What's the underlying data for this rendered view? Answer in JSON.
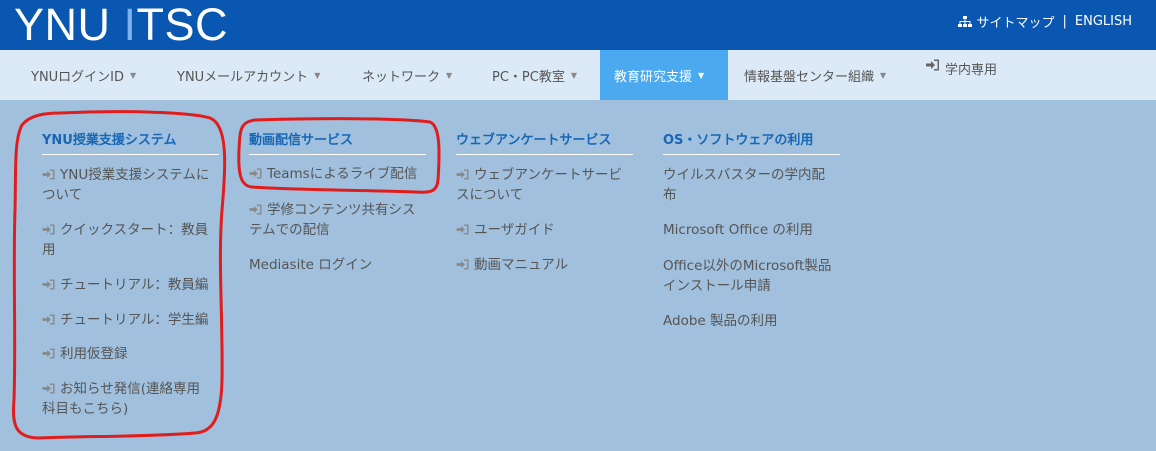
{
  "header": {
    "logo_main": "YNU ",
    "logo_i": "I",
    "logo_rest": "TSC",
    "sitemap_label": "サイトマップ",
    "separator": "|",
    "english_label": "ENGLISH",
    "sitemap_icon": "sitemap-icon"
  },
  "nav": {
    "items": [
      {
        "label": "YNUログインID"
      },
      {
        "label": "YNUメールアカウント"
      },
      {
        "label": "ネットワーク"
      },
      {
        "label": "PC・PC教室"
      },
      {
        "label": "教育研究支援"
      },
      {
        "label": "情報基盤センター組織"
      },
      {
        "label": "学内専用"
      }
    ],
    "active_index": 4,
    "caret_glyph": "▼"
  },
  "menu": {
    "columns": [
      {
        "heading": "YNU授業支援システム",
        "links": [
          {
            "line1": "YNU授業支援システムに",
            "line2": "ついて",
            "icon": true
          },
          {
            "line1": "クイックスタート：教員",
            "line2": "用",
            "icon": true
          },
          {
            "line1": "チュートリアル：教員編",
            "line2": "",
            "icon": true
          },
          {
            "line1": "チュートリアル：学生編",
            "line2": "",
            "icon": true
          },
          {
            "line1": "利用仮登録",
            "line2": "",
            "icon": true
          },
          {
            "line1": "お知らせ発信(連絡専用",
            "line2": "科目もこちら)",
            "icon": true
          }
        ]
      },
      {
        "heading": "動画配信サービス",
        "links": [
          {
            "line1": "Teamsによるライブ配信",
            "line2": "",
            "icon": true
          },
          {
            "line1": "学修コンテンツ共有シス",
            "line2": "テムでの配信",
            "icon": true
          },
          {
            "line1": "Mediasite ログイン",
            "line2": "",
            "icon": false
          }
        ]
      },
      {
        "heading": "ウェブアンケートサービス",
        "links": [
          {
            "line1": "ウェブアンケートサービ",
            "line2": "スについて",
            "icon": true
          },
          {
            "line1": "ユーザガイド",
            "line2": "",
            "icon": true
          },
          {
            "line1": "動画マニュアル",
            "line2": "",
            "icon": true
          }
        ]
      },
      {
        "heading": "OS・ソフトウェアの利用",
        "links": [
          {
            "line1": "ウイルスバスターの学内配",
            "line2": "布",
            "icon": false
          },
          {
            "line1": "Microsoft Office の利用",
            "line2": "",
            "icon": false
          },
          {
            "line1": "Office以外のMicrosoft製品",
            "line2": "インストール申請",
            "icon": false
          },
          {
            "line1": "Adobe 製品の利用",
            "line2": "",
            "icon": false
          }
        ]
      }
    ]
  },
  "colors": {
    "header_bg": "#0a57b1",
    "nav_bg": "#dceaf7",
    "active_tab": "#4aa9ef",
    "menu_bg": "#a0c0dd",
    "heading_text": "#1767b6",
    "annotation": "#e01d1d"
  }
}
